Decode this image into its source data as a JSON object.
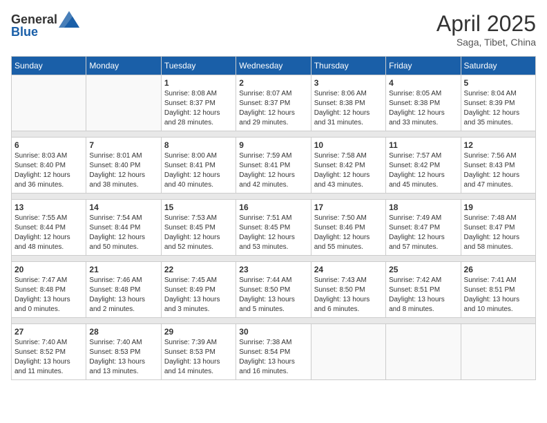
{
  "header": {
    "logo": {
      "text_general": "General",
      "text_blue": "Blue"
    },
    "title": "April 2025",
    "subtitle": "Saga, Tibet, China"
  },
  "weekdays": [
    "Sunday",
    "Monday",
    "Tuesday",
    "Wednesday",
    "Thursday",
    "Friday",
    "Saturday"
  ],
  "weeks": [
    [
      {
        "day": "",
        "sunrise": "",
        "sunset": "",
        "daylight": ""
      },
      {
        "day": "",
        "sunrise": "",
        "sunset": "",
        "daylight": ""
      },
      {
        "day": "1",
        "sunrise": "Sunrise: 8:08 AM",
        "sunset": "Sunset: 8:37 PM",
        "daylight": "Daylight: 12 hours and 28 minutes."
      },
      {
        "day": "2",
        "sunrise": "Sunrise: 8:07 AM",
        "sunset": "Sunset: 8:37 PM",
        "daylight": "Daylight: 12 hours and 29 minutes."
      },
      {
        "day": "3",
        "sunrise": "Sunrise: 8:06 AM",
        "sunset": "Sunset: 8:38 PM",
        "daylight": "Daylight: 12 hours and 31 minutes."
      },
      {
        "day": "4",
        "sunrise": "Sunrise: 8:05 AM",
        "sunset": "Sunset: 8:38 PM",
        "daylight": "Daylight: 12 hours and 33 minutes."
      },
      {
        "day": "5",
        "sunrise": "Sunrise: 8:04 AM",
        "sunset": "Sunset: 8:39 PM",
        "daylight": "Daylight: 12 hours and 35 minutes."
      }
    ],
    [
      {
        "day": "6",
        "sunrise": "Sunrise: 8:03 AM",
        "sunset": "Sunset: 8:40 PM",
        "daylight": "Daylight: 12 hours and 36 minutes."
      },
      {
        "day": "7",
        "sunrise": "Sunrise: 8:01 AM",
        "sunset": "Sunset: 8:40 PM",
        "daylight": "Daylight: 12 hours and 38 minutes."
      },
      {
        "day": "8",
        "sunrise": "Sunrise: 8:00 AM",
        "sunset": "Sunset: 8:41 PM",
        "daylight": "Daylight: 12 hours and 40 minutes."
      },
      {
        "day": "9",
        "sunrise": "Sunrise: 7:59 AM",
        "sunset": "Sunset: 8:41 PM",
        "daylight": "Daylight: 12 hours and 42 minutes."
      },
      {
        "day": "10",
        "sunrise": "Sunrise: 7:58 AM",
        "sunset": "Sunset: 8:42 PM",
        "daylight": "Daylight: 12 hours and 43 minutes."
      },
      {
        "day": "11",
        "sunrise": "Sunrise: 7:57 AM",
        "sunset": "Sunset: 8:42 PM",
        "daylight": "Daylight: 12 hours and 45 minutes."
      },
      {
        "day": "12",
        "sunrise": "Sunrise: 7:56 AM",
        "sunset": "Sunset: 8:43 PM",
        "daylight": "Daylight: 12 hours and 47 minutes."
      }
    ],
    [
      {
        "day": "13",
        "sunrise": "Sunrise: 7:55 AM",
        "sunset": "Sunset: 8:44 PM",
        "daylight": "Daylight: 12 hours and 48 minutes."
      },
      {
        "day": "14",
        "sunrise": "Sunrise: 7:54 AM",
        "sunset": "Sunset: 8:44 PM",
        "daylight": "Daylight: 12 hours and 50 minutes."
      },
      {
        "day": "15",
        "sunrise": "Sunrise: 7:53 AM",
        "sunset": "Sunset: 8:45 PM",
        "daylight": "Daylight: 12 hours and 52 minutes."
      },
      {
        "day": "16",
        "sunrise": "Sunrise: 7:51 AM",
        "sunset": "Sunset: 8:45 PM",
        "daylight": "Daylight: 12 hours and 53 minutes."
      },
      {
        "day": "17",
        "sunrise": "Sunrise: 7:50 AM",
        "sunset": "Sunset: 8:46 PM",
        "daylight": "Daylight: 12 hours and 55 minutes."
      },
      {
        "day": "18",
        "sunrise": "Sunrise: 7:49 AM",
        "sunset": "Sunset: 8:47 PM",
        "daylight": "Daylight: 12 hours and 57 minutes."
      },
      {
        "day": "19",
        "sunrise": "Sunrise: 7:48 AM",
        "sunset": "Sunset: 8:47 PM",
        "daylight": "Daylight: 12 hours and 58 minutes."
      }
    ],
    [
      {
        "day": "20",
        "sunrise": "Sunrise: 7:47 AM",
        "sunset": "Sunset: 8:48 PM",
        "daylight": "Daylight: 13 hours and 0 minutes."
      },
      {
        "day": "21",
        "sunrise": "Sunrise: 7:46 AM",
        "sunset": "Sunset: 8:48 PM",
        "daylight": "Daylight: 13 hours and 2 minutes."
      },
      {
        "day": "22",
        "sunrise": "Sunrise: 7:45 AM",
        "sunset": "Sunset: 8:49 PM",
        "daylight": "Daylight: 13 hours and 3 minutes."
      },
      {
        "day": "23",
        "sunrise": "Sunrise: 7:44 AM",
        "sunset": "Sunset: 8:50 PM",
        "daylight": "Daylight: 13 hours and 5 minutes."
      },
      {
        "day": "24",
        "sunrise": "Sunrise: 7:43 AM",
        "sunset": "Sunset: 8:50 PM",
        "daylight": "Daylight: 13 hours and 6 minutes."
      },
      {
        "day": "25",
        "sunrise": "Sunrise: 7:42 AM",
        "sunset": "Sunset: 8:51 PM",
        "daylight": "Daylight: 13 hours and 8 minutes."
      },
      {
        "day": "26",
        "sunrise": "Sunrise: 7:41 AM",
        "sunset": "Sunset: 8:51 PM",
        "daylight": "Daylight: 13 hours and 10 minutes."
      }
    ],
    [
      {
        "day": "27",
        "sunrise": "Sunrise: 7:40 AM",
        "sunset": "Sunset: 8:52 PM",
        "daylight": "Daylight: 13 hours and 11 minutes."
      },
      {
        "day": "28",
        "sunrise": "Sunrise: 7:40 AM",
        "sunset": "Sunset: 8:53 PM",
        "daylight": "Daylight: 13 hours and 13 minutes."
      },
      {
        "day": "29",
        "sunrise": "Sunrise: 7:39 AM",
        "sunset": "Sunset: 8:53 PM",
        "daylight": "Daylight: 13 hours and 14 minutes."
      },
      {
        "day": "30",
        "sunrise": "Sunrise: 7:38 AM",
        "sunset": "Sunset: 8:54 PM",
        "daylight": "Daylight: 13 hours and 16 minutes."
      },
      {
        "day": "",
        "sunrise": "",
        "sunset": "",
        "daylight": ""
      },
      {
        "day": "",
        "sunrise": "",
        "sunset": "",
        "daylight": ""
      },
      {
        "day": "",
        "sunrise": "",
        "sunset": "",
        "daylight": ""
      }
    ]
  ]
}
